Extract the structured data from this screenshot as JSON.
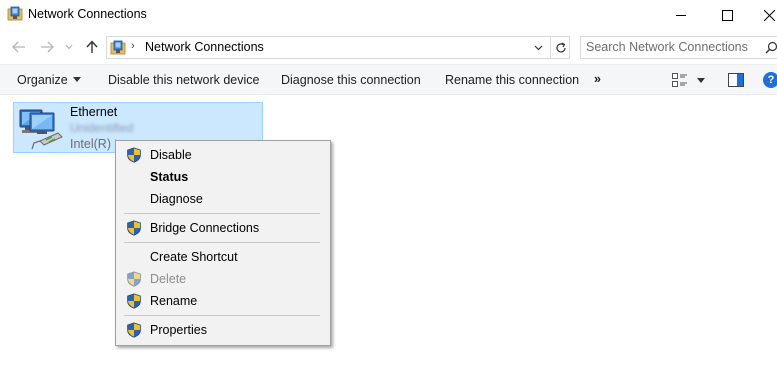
{
  "window": {
    "title": "Network Connections"
  },
  "address_bar": {
    "location": "Network Connections",
    "separator": "›"
  },
  "search": {
    "placeholder": "Search Network Connections"
  },
  "command_bar": {
    "organize_label": "Organize",
    "disable_label": "Disable this network device",
    "diagnose_label": "Diagnose this connection",
    "rename_label": "Rename this connection",
    "more_label": "»",
    "help_label": "?"
  },
  "network_item": {
    "name": "Ethernet",
    "status_obscured": "Unidentified",
    "device": "Intel(R) E"
  },
  "context_menu": {
    "items": [
      {
        "label": "Disable",
        "shield": true,
        "bold": false,
        "disabled": false
      },
      {
        "label": "Status",
        "shield": false,
        "bold": true,
        "disabled": false
      },
      {
        "label": "Diagnose",
        "shield": false,
        "bold": false,
        "disabled": false
      },
      {
        "label": "Bridge Connections",
        "shield": true,
        "bold": false,
        "disabled": false
      },
      {
        "label": "Create Shortcut",
        "shield": false,
        "bold": false,
        "disabled": false
      },
      {
        "label": "Delete",
        "shield": true,
        "bold": false,
        "disabled": true
      },
      {
        "label": "Rename",
        "shield": true,
        "bold": false,
        "disabled": false
      },
      {
        "label": "Properties",
        "shield": true,
        "bold": false,
        "disabled": false
      }
    ]
  },
  "colors": {
    "selection_bg": "#cce8ff",
    "selection_border": "#99d1ff",
    "menu_bg": "#f2f2f2",
    "shield_blue": "#2b5fb8",
    "shield_yellow": "#f2c318",
    "help_blue": "#1e6fd9"
  }
}
